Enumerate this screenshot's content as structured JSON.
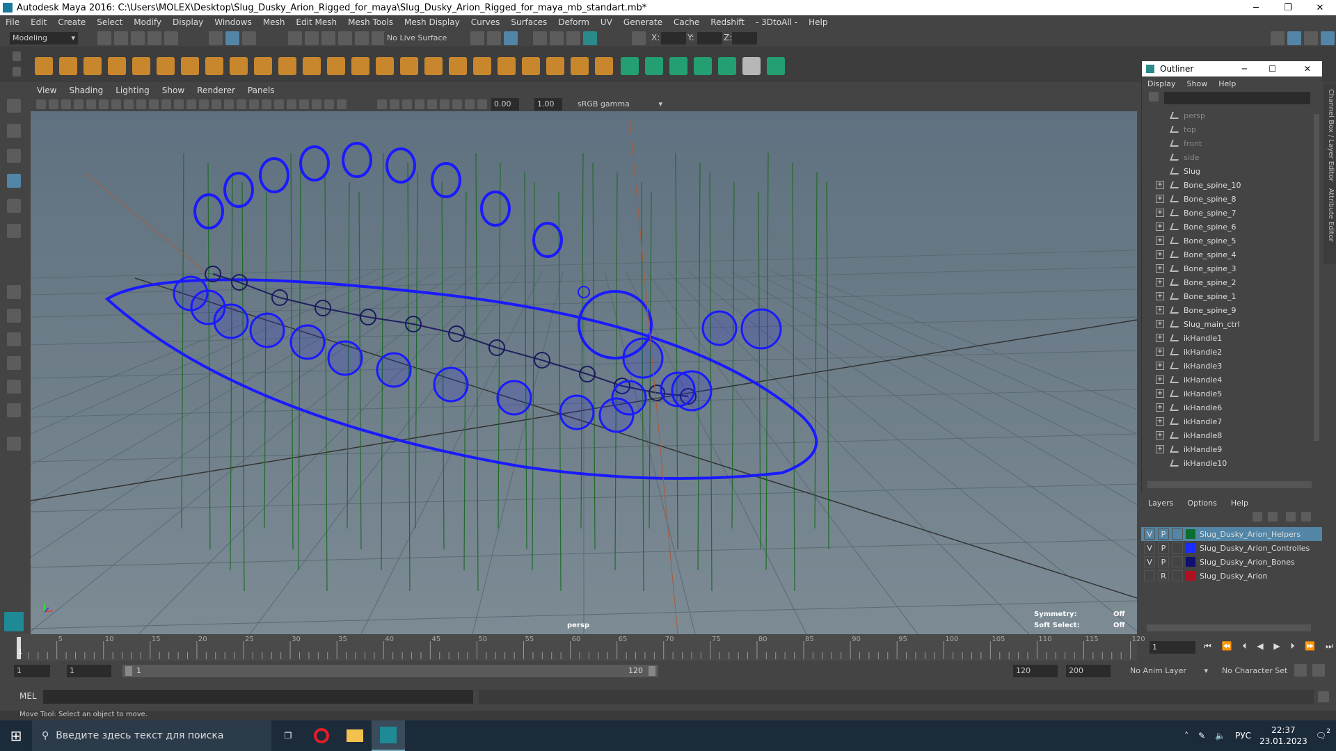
{
  "window": {
    "title": "Autodesk Maya 2016: C:\\Users\\MOLEX\\Desktop\\Slug_Dusky_Arion_Rigged_for_maya\\Slug_Dusky_Arion_Rigged_for_maya_mb_standart.mb*",
    "minimize": "─",
    "maximize": "❐",
    "close": "✕"
  },
  "menubar": [
    "File",
    "Edit",
    "Create",
    "Select",
    "Modify",
    "Display",
    "Windows",
    "Mesh",
    "Edit Mesh",
    "Mesh Tools",
    "Mesh Display",
    "Curves",
    "Surfaces",
    "Deform",
    "UV",
    "Generate",
    "Cache",
    "Redshift",
    "- 3DtoAll -",
    "Help"
  ],
  "statusline": {
    "mode": "Modeling",
    "live_surface": "No Live Surface",
    "x_label": "X:",
    "y_label": "Y:",
    "z_label": "Z:"
  },
  "viewport": {
    "menus": [
      "View",
      "Shading",
      "Lighting",
      "Show",
      "Renderer",
      "Panels"
    ],
    "exposure": "0.00",
    "gamma": "1.00",
    "colorspace": "sRGB gamma",
    "camera_label": "persp",
    "symmetry_label": "Symmetry:",
    "symmetry_value": "Off",
    "soft_select_label": "Soft Select:",
    "soft_select_value": "Off"
  },
  "outliner": {
    "title": "Outliner",
    "menus": [
      "Display",
      "Show",
      "Help"
    ],
    "items": [
      {
        "label": "persp",
        "expandable": false,
        "dim": true
      },
      {
        "label": "top",
        "expandable": false,
        "dim": true
      },
      {
        "label": "front",
        "expandable": false,
        "dim": true
      },
      {
        "label": "side",
        "expandable": false,
        "dim": true
      },
      {
        "label": "Slug",
        "expandable": false,
        "dim": false
      },
      {
        "label": "Bone_spine_10",
        "expandable": true,
        "dim": false
      },
      {
        "label": "Bone_spine_8",
        "expandable": true,
        "dim": false
      },
      {
        "label": "Bone_spine_7",
        "expandable": true,
        "dim": false
      },
      {
        "label": "Bone_spine_6",
        "expandable": true,
        "dim": false
      },
      {
        "label": "Bone_spine_5",
        "expandable": true,
        "dim": false
      },
      {
        "label": "Bone_spine_4",
        "expandable": true,
        "dim": false
      },
      {
        "label": "Bone_spine_3",
        "expandable": true,
        "dim": false
      },
      {
        "label": "Bone_spine_2",
        "expandable": true,
        "dim": false
      },
      {
        "label": "Bone_spine_1",
        "expandable": true,
        "dim": false
      },
      {
        "label": "Bone_spine_9",
        "expandable": true,
        "dim": false
      },
      {
        "label": "Slug_main_ctrl",
        "expandable": true,
        "dim": false
      },
      {
        "label": "ikHandle1",
        "expandable": true,
        "dim": false
      },
      {
        "label": "ikHandle2",
        "expandable": true,
        "dim": false
      },
      {
        "label": "ikHandle3",
        "expandable": true,
        "dim": false
      },
      {
        "label": "ikHandle4",
        "expandable": true,
        "dim": false
      },
      {
        "label": "ikHandle5",
        "expandable": true,
        "dim": false
      },
      {
        "label": "ikHandle6",
        "expandable": true,
        "dim": false
      },
      {
        "label": "ikHandle7",
        "expandable": true,
        "dim": false
      },
      {
        "label": "ikHandle8",
        "expandable": true,
        "dim": false
      },
      {
        "label": "ikHandle9",
        "expandable": true,
        "dim": false
      },
      {
        "label": "ikHandle10",
        "expandable": false,
        "dim": false
      }
    ]
  },
  "layers": {
    "menus": [
      "Layers",
      "Options",
      "Help"
    ],
    "rows": [
      {
        "v": "V",
        "p": "P",
        "color": "#0a6e2e",
        "name": "Slug_Dusky_Arion_Helpers",
        "selected": true
      },
      {
        "v": "V",
        "p": "P",
        "color": "#1a2cff",
        "name": "Slug_Dusky_Arion_Controlles",
        "selected": false
      },
      {
        "v": "V",
        "p": "P",
        "color": "#101070",
        "name": "Slug_Dusky_Arion_Bones",
        "selected": false
      },
      {
        "v": "",
        "p": "R",
        "color": "#b01020",
        "name": "Slug_Dusky_Arion",
        "selected": false
      }
    ]
  },
  "timeline": {
    "ticks": [
      "5",
      "10",
      "15",
      "20",
      "25",
      "30",
      "35",
      "40",
      "45",
      "50",
      "55",
      "60",
      "65",
      "70",
      "75",
      "80",
      "85",
      "90",
      "95",
      "100",
      "105",
      "110",
      "115",
      "120"
    ],
    "current_frame_marker": "1",
    "current_frame_field": "1"
  },
  "range": {
    "start": "1",
    "start2": "1",
    "slider_start": "1",
    "slider_end": "120",
    "end": "120",
    "end2": "200",
    "anim_layer": "No Anim Layer",
    "character_set": "No Character Set"
  },
  "cmdline": {
    "mel_label": "MEL"
  },
  "helpline": {
    "text": "Move Tool: Select an object to move."
  },
  "taskbar": {
    "search_placeholder": "Введите здесь текст для поиска",
    "lang": "РУС",
    "time": "22:37",
    "date": "23.01.2023",
    "notif_count": "2"
  },
  "colors": {
    "rig_blue": "#1a1aff",
    "selection": "#5285a6",
    "grid_green": "#1f6b2a"
  }
}
